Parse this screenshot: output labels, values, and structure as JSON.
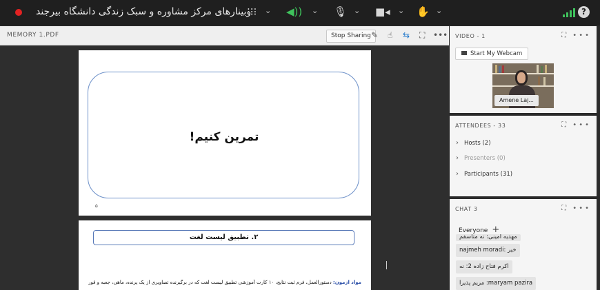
{
  "topbar": {
    "meeting_title": "وبینارهای مرکز مشاوره و سبک زندگی دانشگاه بیرجند",
    "help_label": "?"
  },
  "share": {
    "pod_title": "MEMORY 1.PDF",
    "stop_sharing_label": "Stop Sharing"
  },
  "slide1": {
    "heading": "تمرین کنیم!",
    "page_number": "۵"
  },
  "slide2": {
    "heading": "۲. تطبیق لیست لغت",
    "body_label": "مواد آزمون:",
    "body_text": "دستورالعمل، فرم ثبت نتایج، ۱۰ کارت آموزشی تطبیق لیست لغت که در برگیرنده تصاویری از یک پرنده، ماهی، جعبه و قورباغه و"
  },
  "video": {
    "pod_title": "VIDEO - 1",
    "webcam_button": "Start My Webcam",
    "participant_name": "Amene Laj..."
  },
  "attendees": {
    "pod_title": "ATTENDEES - 33",
    "groups": [
      {
        "label": "Hosts (2)"
      },
      {
        "label": "Presenters (0)"
      },
      {
        "label": "Participants (31)"
      }
    ]
  },
  "chat": {
    "pod_title": "CHAT 3",
    "recipient": "Everyone",
    "messages": [
      {
        "text": "مهدیه امینی: نه متاسفم"
      },
      {
        "text": "najmeh moradi: خیر"
      },
      {
        "text": "اکرم فتاح زاده 2: نه"
      },
      {
        "text": "مریم پذیرا :maryam pazira"
      }
    ]
  },
  "colors": {
    "recording": "#e32222",
    "signal": "#3fc25c",
    "slide_border": "#6b8fc8"
  }
}
